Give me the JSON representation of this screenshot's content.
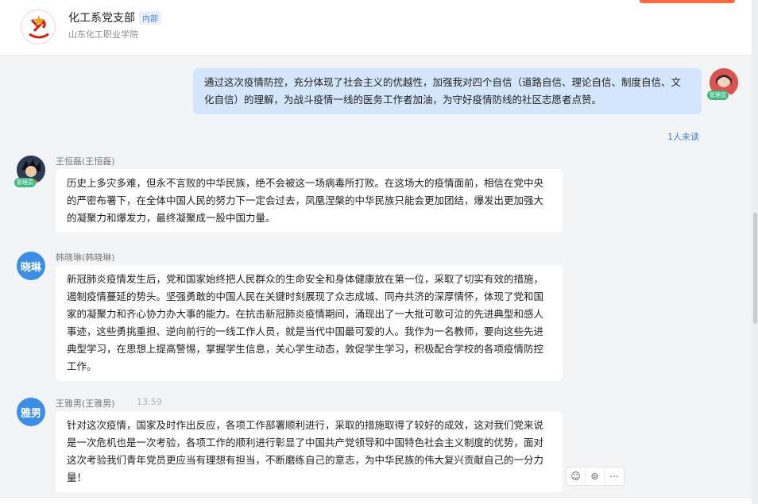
{
  "header": {
    "group_name": "化工系党支部",
    "tag": "内部",
    "subtitle": "山东化工职业学院"
  },
  "messages": [
    {
      "side": "right",
      "text": "通过这次疫情防控，充分体现了社会主义的优越性，加强我对四个自信（道路自信、理论自信、制度自信、文化自信）的理解，为战斗疫情一线的医务工作者加油，为守好疫情防线的社区志愿者点赞。",
      "unread": "1人未读",
      "role_tag": "管理员"
    },
    {
      "sender": "王恒磊(王恒磊)",
      "role_tag": "管理员",
      "text": "历史上多灾多难，但永不言败的中华民族，绝不会被这一场病毒所打败。在这场大的疫情面前，相信在党中央的严密布署下，在全体中国人民的努力下一定会过去，凤凰涅槃的中华民族只能会更加团结，爆发出更加强大的凝聚力和爆发力，最终凝聚成一股中国力量。"
    },
    {
      "sender": "韩晓琳(韩晓琳)",
      "avatar_text": "晓琳",
      "text": "新冠肺炎疫情发生后，党和国家始终把人民群众的生命安全和身体健康放在第一位，采取了切实有效的措施，遏制疫情蔓延的势头。坚强勇敢的中国人民在关键时刻展现了众志成城、同舟共济的深厚情怀，体现了党和国家的凝聚力和齐心协力办大事的能力。在抗击新冠肺炎疫情期间，涌现出了一大批可歌可泣的先进典型和感人事迹，这些勇挑重担、逆向前行的一线工作人员，就是当代中国最可爱的人。我作为一名教师，要向这些先进典型学习，在思想上提高警惕，掌握学生信息，关心学生动态，敦促学生学习，积极配合学校的各项疫情防控工作。"
    },
    {
      "sender": "王雅男(王雅男)",
      "avatar_text": "雅男",
      "time": "13:59",
      "text": "针对这次疫情，国家及时作出反应，各项工作部署顺利进行，采取的措施取得了较好的成效，这对我们党来说是一次危机也是一次考验，各项工作的顺利进行彰显了中国共产党领导和中国特色社会主义制度的优势，面对这次考验我们青年党员更应当有理想有担当，不断磨练自己的意志，为中华民族的伟大复兴贡献自己的一分力量！"
    }
  ],
  "actions": [
    {
      "icon": "emoji-icon",
      "glyph": "☺"
    },
    {
      "icon": "reply-icon",
      "glyph": "⊜"
    },
    {
      "icon": "more-icon",
      "glyph": "⋯"
    }
  ]
}
